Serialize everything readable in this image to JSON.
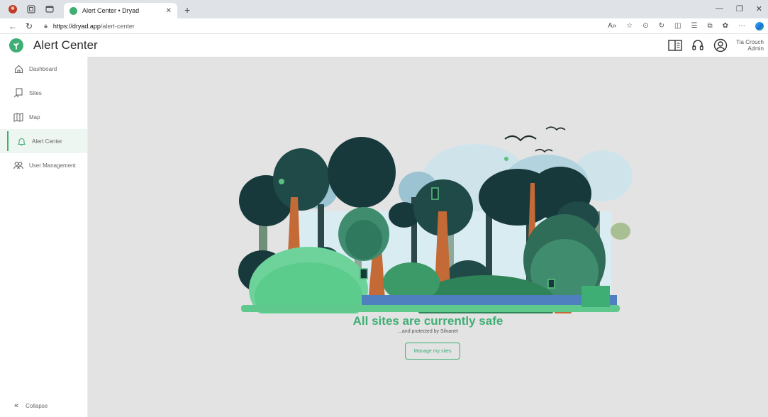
{
  "browser": {
    "tab_title": "Alert Center • Dryad",
    "url_host": "https://dryad.app",
    "url_path": "/alert-center"
  },
  "app": {
    "title": "Alert Center",
    "brand_color": "#3fae74",
    "user_name": "Tia Crouch",
    "user_role": "Admin"
  },
  "sidebar": {
    "items": [
      {
        "label": "Dashboard",
        "icon": "home-icon"
      },
      {
        "label": "Sites",
        "icon": "sites-icon"
      },
      {
        "label": "Map",
        "icon": "map-icon"
      },
      {
        "label": "Alert Center",
        "icon": "bell-icon",
        "active": true
      },
      {
        "label": "User Management",
        "icon": "users-icon"
      }
    ],
    "collapse_label": "Collapse"
  },
  "main": {
    "title": "All sites are currently safe",
    "subtitle": "...and protected by Silvanet",
    "button_label": "Manage my sites"
  }
}
